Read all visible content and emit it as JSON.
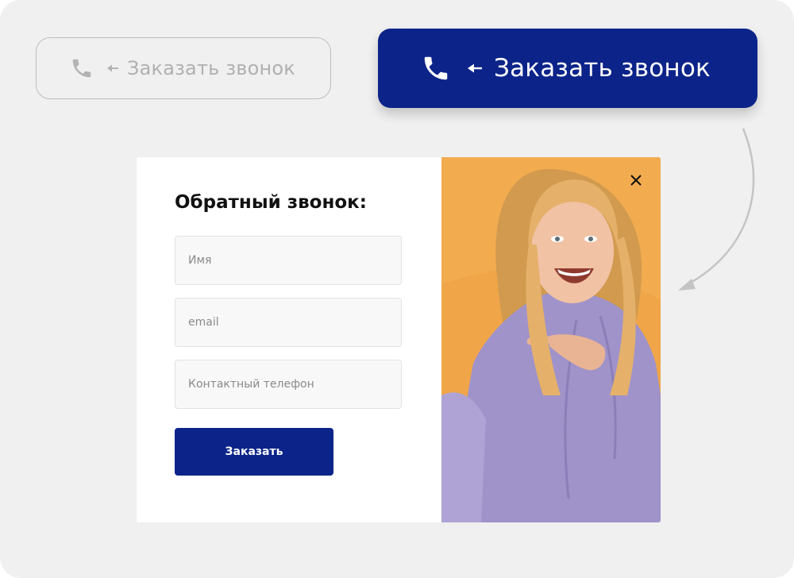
{
  "buttons": {
    "outline": {
      "label": "Заказать звонок",
      "icon": "phone-icon",
      "arrow": "arrow-left-icon"
    },
    "filled": {
      "label": "Заказать звонок",
      "icon": "phone-icon",
      "arrow": "arrow-left-icon"
    }
  },
  "form": {
    "title": "Обратный звонок:",
    "fields": {
      "name_placeholder": "Имя",
      "email_placeholder": "email",
      "phone_placeholder": "Контактный телефон"
    },
    "submit_label": "Заказать",
    "close_icon": "close-icon"
  },
  "colors": {
    "brand": "#0c2489",
    "background": "#f0f0f0",
    "photo_background": "#f0a648",
    "muted": "#b0b0b0"
  }
}
